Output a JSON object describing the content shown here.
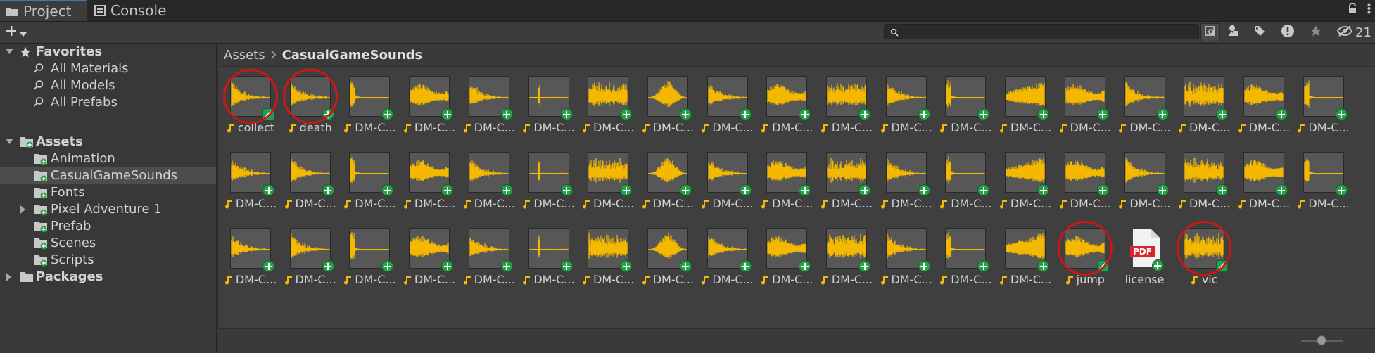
{
  "tabs": [
    {
      "label": "Project",
      "icon": "folder-icon",
      "active": true
    },
    {
      "label": "Console",
      "icon": "console-icon",
      "active": false
    }
  ],
  "toolbar": {
    "search_value": "",
    "hidden_packages_count": "21"
  },
  "sidebar": {
    "items": [
      {
        "label": "Favorites",
        "icon": "star-icon",
        "level": 0,
        "expanded": true,
        "bold": true
      },
      {
        "label": "All Materials",
        "icon": "search-icon",
        "level": 1
      },
      {
        "label": "All Models",
        "icon": "search-icon",
        "level": 1
      },
      {
        "label": "All Prefabs",
        "icon": "search-icon",
        "level": 1
      },
      {
        "label": "Assets",
        "icon": "folder-icon",
        "level": 0,
        "expanded": true,
        "bold": true
      },
      {
        "label": "Animation",
        "icon": "folder-icon",
        "level": 1
      },
      {
        "label": "CasualGameSounds",
        "icon": "folder-icon",
        "level": 1,
        "selected": true
      },
      {
        "label": "Fonts",
        "icon": "folder-icon",
        "level": 1
      },
      {
        "label": "Pixel Adventure 1",
        "icon": "folder-icon",
        "level": 1,
        "expandable": true
      },
      {
        "label": "Prefab",
        "icon": "folder-icon",
        "level": 1
      },
      {
        "label": "Scenes",
        "icon": "folder-icon",
        "level": 1
      },
      {
        "label": "Scripts",
        "icon": "folder-icon",
        "level": 1
      },
      {
        "label": "Packages",
        "icon": "folder-icon",
        "level": 0,
        "expanded": false,
        "bold": true
      }
    ]
  },
  "breadcrumb": {
    "root": "Assets",
    "current": "CasualGameSounds"
  },
  "assets": [
    {
      "label": "collect",
      "type": "audio",
      "badge": "edit",
      "circled": true
    },
    {
      "label": "death",
      "type": "audio",
      "badge": "add",
      "circled": true
    },
    {
      "label": "DM-C...",
      "type": "audio",
      "badge": "add"
    },
    {
      "label": "DM-C...",
      "type": "audio",
      "badge": "add"
    },
    {
      "label": "DM-C...",
      "type": "audio",
      "badge": "add"
    },
    {
      "label": "DM-C...",
      "type": "audio",
      "badge": "add"
    },
    {
      "label": "DM-C...",
      "type": "audio",
      "badge": "add"
    },
    {
      "label": "DM-C...",
      "type": "audio",
      "badge": "add"
    },
    {
      "label": "DM-C...",
      "type": "audio",
      "badge": "add"
    },
    {
      "label": "DM-C...",
      "type": "audio",
      "badge": "add"
    },
    {
      "label": "DM-C...",
      "type": "audio",
      "badge": "add"
    },
    {
      "label": "DM-C...",
      "type": "audio",
      "badge": "add"
    },
    {
      "label": "DM-C...",
      "type": "audio",
      "badge": "add"
    },
    {
      "label": "DM-C...",
      "type": "audio",
      "badge": "add"
    },
    {
      "label": "DM-C...",
      "type": "audio",
      "badge": "add"
    },
    {
      "label": "DM-C...",
      "type": "audio",
      "badge": "add"
    },
    {
      "label": "DM-C...",
      "type": "audio",
      "badge": "add"
    },
    {
      "label": "DM-C...",
      "type": "audio",
      "badge": "add"
    },
    {
      "label": "DM-C...",
      "type": "audio",
      "badge": "add"
    },
    {
      "label": "DM-C...",
      "type": "audio",
      "badge": "add"
    },
    {
      "label": "DM-C...",
      "type": "audio",
      "badge": "add"
    },
    {
      "label": "DM-C...",
      "type": "audio",
      "badge": "add"
    },
    {
      "label": "DM-C...",
      "type": "audio",
      "badge": "add"
    },
    {
      "label": "DM-C...",
      "type": "audio",
      "badge": "add"
    },
    {
      "label": "DM-C...",
      "type": "audio",
      "badge": "add"
    },
    {
      "label": "DM-C...",
      "type": "audio",
      "badge": "add"
    },
    {
      "label": "DM-C...",
      "type": "audio",
      "badge": "add"
    },
    {
      "label": "DM-C...",
      "type": "audio",
      "badge": "add"
    },
    {
      "label": "DM-C...",
      "type": "audio",
      "badge": "add"
    },
    {
      "label": "DM-C...",
      "type": "audio",
      "badge": "add"
    },
    {
      "label": "DM-C...",
      "type": "audio",
      "badge": "add"
    },
    {
      "label": "DM-C...",
      "type": "audio",
      "badge": "add"
    },
    {
      "label": "DM-C...",
      "type": "audio",
      "badge": "add"
    },
    {
      "label": "DM-C...",
      "type": "audio",
      "badge": "add"
    },
    {
      "label": "DM-C...",
      "type": "audio",
      "badge": "add"
    },
    {
      "label": "DM-C...",
      "type": "audio",
      "badge": "add"
    },
    {
      "label": "DM-C...",
      "type": "audio",
      "badge": "add"
    },
    {
      "label": "DM-C...",
      "type": "audio",
      "badge": "add"
    },
    {
      "label": "DM-C...",
      "type": "audio",
      "badge": "add"
    },
    {
      "label": "DM-C...",
      "type": "audio",
      "badge": "add"
    },
    {
      "label": "DM-C...",
      "type": "audio",
      "badge": "add"
    },
    {
      "label": "DM-C...",
      "type": "audio",
      "badge": "add"
    },
    {
      "label": "DM-C...",
      "type": "audio",
      "badge": "add"
    },
    {
      "label": "DM-C...",
      "type": "audio",
      "badge": "add"
    },
    {
      "label": "DM-C...",
      "type": "audio",
      "badge": "add"
    },
    {
      "label": "DM-C...",
      "type": "audio",
      "badge": "add"
    },
    {
      "label": "DM-C...",
      "type": "audio",
      "badge": "add"
    },
    {
      "label": "DM-C...",
      "type": "audio",
      "badge": "add"
    },
    {
      "label": "DM-C...",
      "type": "audio",
      "badge": "add"
    },
    {
      "label": "DM-C...",
      "type": "audio",
      "badge": "add"
    },
    {
      "label": "DM-C...",
      "type": "audio",
      "badge": "add"
    },
    {
      "label": "DM-C...",
      "type": "audio",
      "badge": "add"
    },
    {
      "label": "jump",
      "type": "audio",
      "badge": "edit",
      "circled": true
    },
    {
      "label": "license",
      "type": "pdf",
      "badge": "add",
      "thumb_text": "PDF"
    },
    {
      "label": "vic",
      "type": "audio",
      "badge": "edit",
      "circled": true
    }
  ],
  "colors": {
    "waveform": "#f5b800",
    "badge": "#27a04a",
    "annotation": "#d01515",
    "accent": "#3a79bb"
  }
}
